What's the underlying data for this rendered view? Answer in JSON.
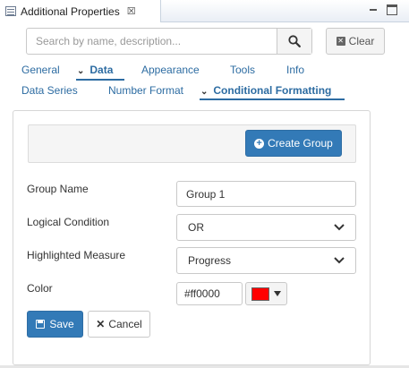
{
  "view": {
    "title": "Additional Properties",
    "close_glyph": "☒"
  },
  "search": {
    "placeholder": "Search by name, description...",
    "value": "",
    "clear_label": "Clear"
  },
  "tabs_row1": [
    {
      "label": "General",
      "active": false
    },
    {
      "label": "Data",
      "active": true
    },
    {
      "label": "Appearance",
      "active": false
    },
    {
      "label": "Tools",
      "active": false
    },
    {
      "label": "Info",
      "active": false
    }
  ],
  "tabs_row2": [
    {
      "label": "Data Series",
      "active": false
    },
    {
      "label": "Number Format",
      "active": false
    },
    {
      "label": "Conditional Formatting",
      "active": true
    }
  ],
  "create_group": {
    "label": "Create Group"
  },
  "form": {
    "group_name": {
      "label": "Group Name",
      "value": "Group 1"
    },
    "logical_condition": {
      "label": "Logical Condition",
      "value": "OR"
    },
    "highlighted_measure": {
      "label": "Highlighted Measure",
      "value": "Progress"
    },
    "color": {
      "label": "Color",
      "value": "#ff0000",
      "swatch": "#ff0000"
    }
  },
  "buttons": {
    "save": "Save",
    "cancel": "Cancel"
  },
  "colors": {
    "accent": "#337ab7",
    "link": "#2d6ca2"
  }
}
